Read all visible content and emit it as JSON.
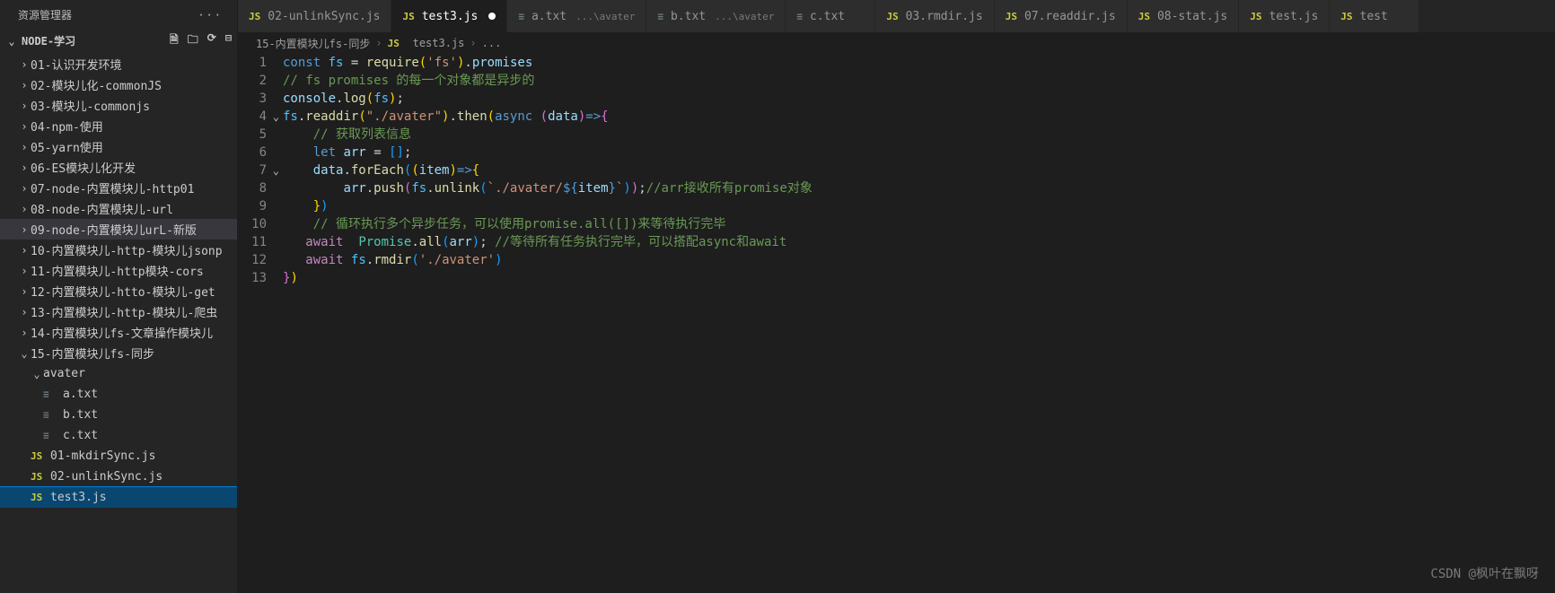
{
  "sidebar": {
    "title": "资源管理器",
    "root_label": "NODE-学习",
    "folders": [
      "01-认识开发环境",
      "02-模块儿化-commonJS",
      "03-模块儿-commonjs",
      "04-npm-使用",
      "05-yarn使用",
      "06-ES模块儿化开发",
      "07-node-内置模块儿-http01",
      "08-node-内置模块儿-url",
      "09-node-内置模块儿urL-新版",
      "10-内置模块儿-http-模块儿jsonp",
      "11-内置模块儿-http模块-cors",
      "12-内置模块儿-htto-模块儿-get",
      "13-内置模块儿-http-模块儿-爬虫",
      "14-内置模块儿fs-文章操作模块儿"
    ],
    "open_folder": "15-内置模块儿fs-同步",
    "avater_folder": "avater",
    "avater_files": [
      "a.txt",
      "b.txt",
      "c.txt"
    ],
    "js_files": [
      "01-mkdirSync.js",
      "02-unlinkSync.js",
      "test3.js"
    ]
  },
  "tabs": [
    {
      "icon": "JS",
      "label": "02-unlinkSync.js",
      "type": "js",
      "active": false,
      "dirty": false
    },
    {
      "icon": "JS",
      "label": "test3.js",
      "type": "js",
      "active": true,
      "dirty": true
    },
    {
      "icon": "≡",
      "label": "a.txt",
      "sub": "...\\avater",
      "type": "txt",
      "active": false
    },
    {
      "icon": "≡",
      "label": "b.txt",
      "sub": "...\\avater",
      "type": "txt",
      "active": false
    },
    {
      "icon": "≡",
      "label": "c.txt",
      "type": "txt",
      "active": false
    },
    {
      "icon": "JS",
      "label": "03.rmdir.js",
      "type": "js",
      "active": false
    },
    {
      "icon": "JS",
      "label": "07.readdir.js",
      "type": "js",
      "active": false
    },
    {
      "icon": "JS",
      "label": "08-stat.js",
      "type": "js",
      "active": false
    },
    {
      "icon": "JS",
      "label": "test.js",
      "type": "js",
      "active": false
    },
    {
      "icon": "JS",
      "label": "test",
      "type": "js",
      "active": false
    }
  ],
  "breadcrumb": {
    "parts": [
      "15-内置模块儿fs-同步",
      "test3.js",
      "..."
    ],
    "icon": "JS"
  },
  "code": {
    "lines": [
      {
        "n": 1,
        "html": "<span class='tk-kw'>const</span> <span class='tk-const'>fs</span> <span class='tk-p'>=</span> <span class='tk-fn'>require</span><span class='tk-br1'>(</span><span class='tk-str'>'fs'</span><span class='tk-br1'>)</span><span class='tk-p'>.</span><span class='tk-var'>promises</span>"
      },
      {
        "n": 2,
        "html": "<span class='tk-cm'>// fs promises 的每一个对象都是异步的</span>"
      },
      {
        "n": 3,
        "html": "<span class='tk-var'>console</span><span class='tk-p'>.</span><span class='tk-fn'>log</span><span class='tk-br1'>(</span><span class='tk-const'>fs</span><span class='tk-br1'>)</span><span class='tk-p'>;</span>"
      },
      {
        "n": 4,
        "fold": true,
        "html": "<span class='tk-const'>fs</span><span class='tk-p'>.</span><span class='tk-fn'>readdir</span><span class='tk-br1'>(</span><span class='tk-str'>\"./avater\"</span><span class='tk-br1'>)</span><span class='tk-p'>.</span><span class='tk-fn'>then</span><span class='tk-br1'>(</span><span class='tk-kw'>async</span> <span class='tk-br2'>(</span><span class='tk-var'>data</span><span class='tk-br2'>)</span><span class='tk-kw'>=&gt;</span><span class='tk-br2'>{</span>"
      },
      {
        "n": 5,
        "html": "    <span class='tk-cm'>// 获取列表信息</span>"
      },
      {
        "n": 6,
        "html": "    <span class='tk-kw'>let</span> <span class='tk-var'>arr</span> <span class='tk-p'>=</span> <span class='tk-br3'>[</span><span class='tk-br3'>]</span><span class='tk-p'>;</span>"
      },
      {
        "n": 7,
        "fold": true,
        "html": "    <span class='tk-var'>data</span><span class='tk-p'>.</span><span class='tk-fn'>forEach</span><span class='tk-br3'>(</span><span class='tk-br1'>(</span><span class='tk-var'>item</span><span class='tk-br1'>)</span><span class='tk-kw'>=&gt;</span><span class='tk-br1'>{</span>"
      },
      {
        "n": 8,
        "html": "        <span class='tk-var'>arr</span><span class='tk-p'>.</span><span class='tk-fn'>push</span><span class='tk-br2'>(</span><span class='tk-const'>fs</span><span class='tk-p'>.</span><span class='tk-fn'>unlink</span><span class='tk-br3'>(</span><span class='tk-str'>`./avater/</span><span class='tk-kw'>${</span><span class='tk-var'>item</span><span class='tk-kw'>}</span><span class='tk-str'>`</span><span class='tk-br3'>)</span><span class='tk-br2'>)</span><span class='tk-p'>;</span><span class='tk-cm'>//arr接收所有promise对象</span>"
      },
      {
        "n": 9,
        "html": "    <span class='tk-br1'>}</span><span class='tk-br3'>)</span>"
      },
      {
        "n": 10,
        "html": "    <span class='tk-cm'>// 循环执行多个异步任务，可以使用promise.all([])来等待执行完毕</span>"
      },
      {
        "n": 11,
        "html": "   <span class='tk-kw2'>await</span>  <span class='tk-obj'>Promise</span><span class='tk-p'>.</span><span class='tk-fn'>all</span><span class='tk-br3'>(</span><span class='tk-var'>arr</span><span class='tk-br3'>)</span><span class='tk-p'>;</span> <span class='tk-cm'>//等待所有任务执行完毕，可以搭配async和await</span>"
      },
      {
        "n": 12,
        "html": "   <span class='tk-kw2'>await</span> <span class='tk-const'>fs</span><span class='tk-p'>.</span><span class='tk-fn'>rmdir</span><span class='tk-br3'>(</span><span class='tk-str'>'./avater'</span><span class='tk-br3'>)</span>"
      },
      {
        "n": 13,
        "html": "<span class='tk-br2'>}</span><span class='tk-br1'>)</span>"
      }
    ]
  },
  "watermark": "CSDN @枫叶在飘呀"
}
